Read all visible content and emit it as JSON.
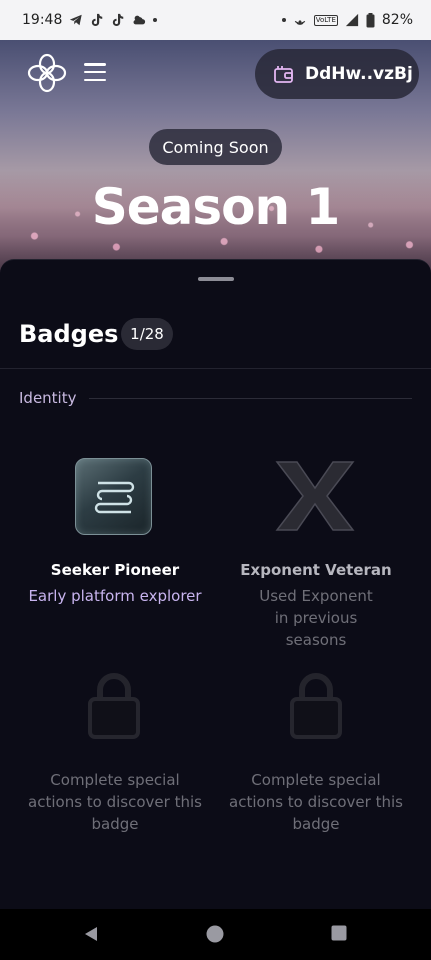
{
  "status_bar": {
    "time": "19:48",
    "battery": "82%",
    "icons": [
      "telegram-icon",
      "tiktok-icon",
      "tiktok-icon",
      "weather-icon",
      "hotspot-icon",
      "volte-icon",
      "signal-icon",
      "battery-icon"
    ],
    "volte_label": "VoLTE"
  },
  "header": {
    "wallet_label": "DdHw..vzBj"
  },
  "hero": {
    "badge_label": "Coming Soon",
    "title": "Season 1"
  },
  "sheet": {
    "title": "Badges",
    "count": "1/28",
    "section": "Identity",
    "badges": [
      {
        "name": "Seeker Pioneer",
        "description": "Early platform explorer",
        "icon": "seeker-logo-icon",
        "unlocked": true
      },
      {
        "name": "Exponent Veteran",
        "description": "Used Exponent in previous seasons",
        "icon": "exponent-x-icon",
        "unlocked": false
      },
      {
        "description": "Complete special actions to discover this badge",
        "icon": "lock-icon",
        "locked": true
      },
      {
        "description": "Complete special actions to discover this badge",
        "icon": "lock-icon",
        "locked": true
      }
    ]
  },
  "colors": {
    "accent": "#c8b4ef",
    "sheet_bg": "#0c0c17",
    "muted": "#6f6f78"
  }
}
